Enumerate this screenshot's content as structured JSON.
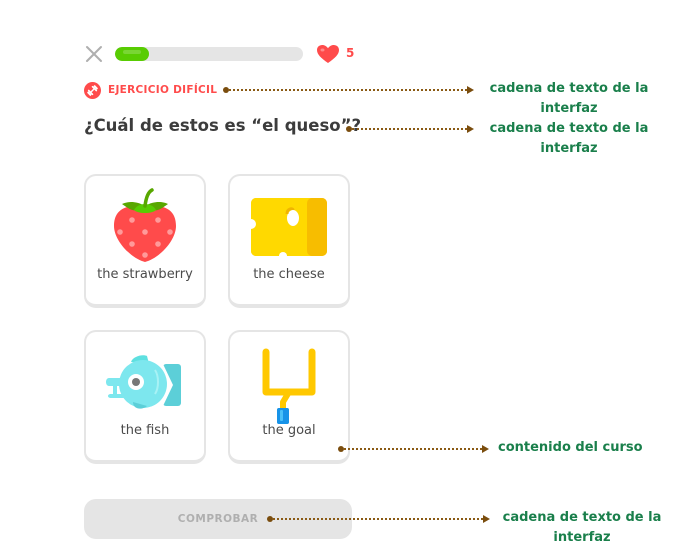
{
  "header": {
    "close_icon": "close-x-icon",
    "progress_fraction": 0.18,
    "hearts_icon": "heart-icon",
    "hearts_count": "5"
  },
  "exercise": {
    "badge_icon": "dumbbell-icon",
    "badge_label": "EJERCICIO DIFÍCIL",
    "question": "¿Cuál de estos es “el queso”?"
  },
  "options": [
    {
      "label": "the strawberry",
      "icon": "strawberry-icon"
    },
    {
      "label": "the cheese",
      "icon": "cheese-icon"
    },
    {
      "label": "the fish",
      "icon": "fish-icon"
    },
    {
      "label": "the goal",
      "icon": "goalpost-icon"
    }
  ],
  "footer": {
    "check_label": "COMPROBAR"
  },
  "annotations": [
    {
      "target": "exercise-badge-label",
      "text": "cadena de texto de la interfaz"
    },
    {
      "target": "question",
      "text": "cadena de texto de la interfaz"
    },
    {
      "target": "option-the-goal",
      "text": "contenido del curso"
    },
    {
      "target": "check-button",
      "text": "cadena de texto de la interfaz"
    }
  ],
  "colors": {
    "accent_green": "#58cc02",
    "danger_red": "#ff4b4b",
    "annotation_green": "#1a7f4b",
    "annotation_brown": "#7a4d0e"
  }
}
